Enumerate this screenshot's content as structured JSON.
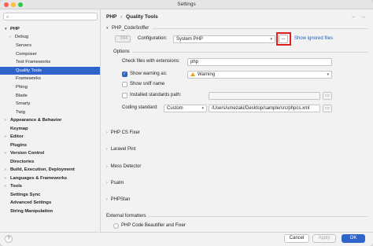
{
  "window": {
    "title": "Settings"
  },
  "search": {
    "placeholder": ""
  },
  "tree": {
    "php": "PHP",
    "debug": "Debug",
    "servers": "Servers",
    "composer": "Composer",
    "test_frameworks": "Test Frameworks",
    "quality_tools": "Quality Tools",
    "frameworks": "Frameworks",
    "phing": "Phing",
    "blade": "Blade",
    "smarty": "Smarty",
    "twig": "Twig",
    "appearance": "Appearance & Behavior",
    "keymap": "Keymap",
    "editor": "Editor",
    "plugins": "Plugins",
    "version_control": "Version Control",
    "directories": "Directories",
    "build": "Build, Execution, Deployment",
    "languages": "Languages & Frameworks",
    "tools": "Tools",
    "settings_sync": "Settings Sync",
    "advanced": "Advanced Settings",
    "string_manipulation": "String Manipulation"
  },
  "breadcrumb": {
    "parent": "PHP",
    "separator": "›",
    "current": "Quality Tools"
  },
  "codesniffer": {
    "section": "PHP_CodeSniffer",
    "toggle": "OFF",
    "config_label": "Configuration:",
    "config_value": "System PHP",
    "dots": "...",
    "show_ignored": "Show ignored files",
    "options_label": "Options",
    "check_ext_label": "Check files with extensions:",
    "check_ext_value": "php",
    "show_warning_label": "Show warning as:",
    "show_warning_value": "Warning",
    "show_sniff_label": "Show sniff name",
    "installed_label": "Installed standards path:",
    "installed_value": "",
    "coding_label": "Coding standard:",
    "coding_value": "Custom",
    "coding_path": "/Users/umezaki/Desktop/sample/src/phpcs.xml"
  },
  "collapsed": {
    "cs_fixer": "PHP CS Fixer",
    "pint": "Laravel Pint",
    "mess": "Mess Detector",
    "psalm": "Psalm",
    "phpstan": "PHPStan"
  },
  "external": {
    "label": "External formatters",
    "option": "PHP Code Beautifier and Fixer"
  },
  "footer": {
    "help": "?",
    "cancel": "Cancel",
    "apply": "Apply",
    "ok": "OK"
  },
  "colors": {
    "accent": "#2f65ca",
    "highlight": "#e02020",
    "link": "#2a5db0"
  }
}
